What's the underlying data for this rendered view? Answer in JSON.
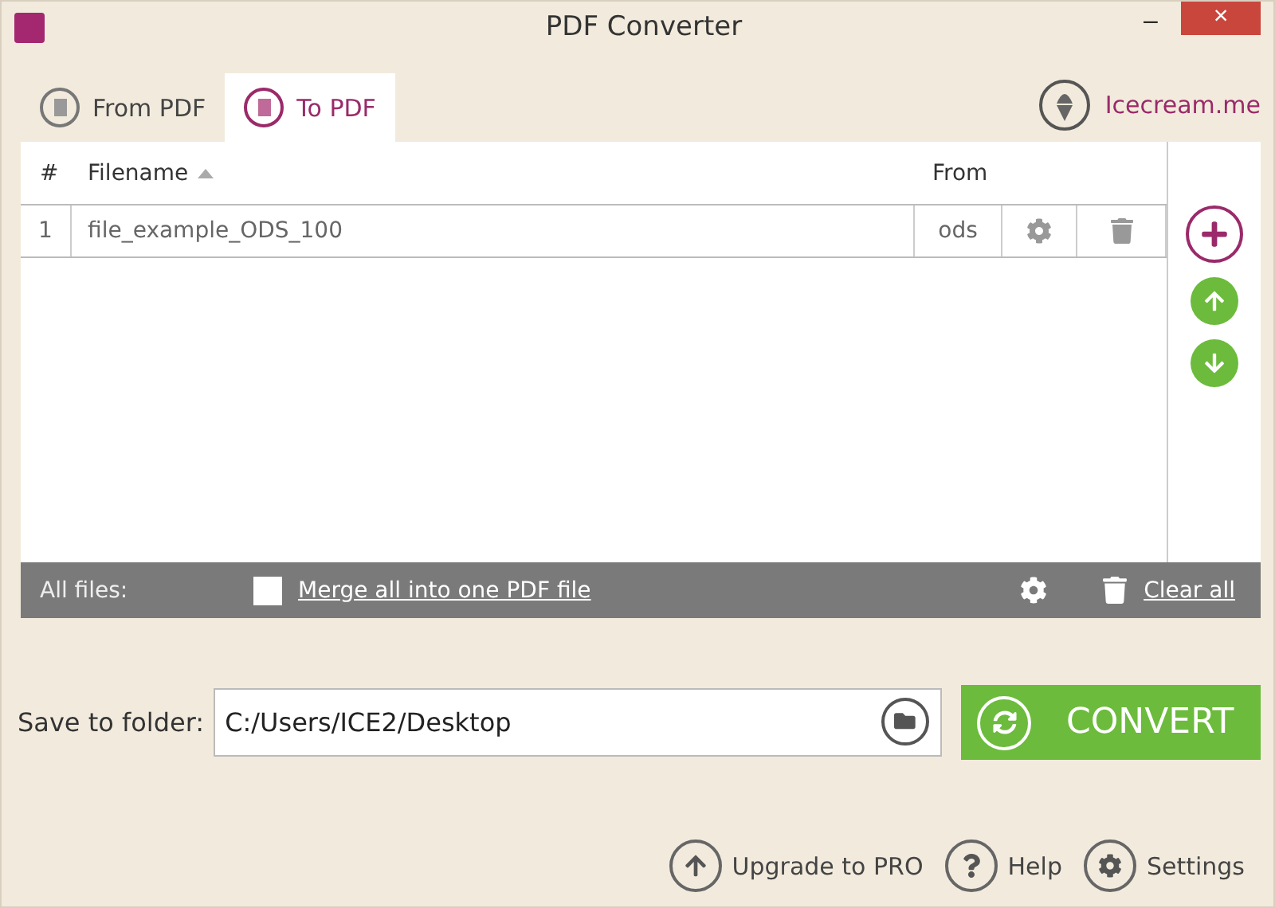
{
  "window": {
    "title": "PDF Converter",
    "close": "×",
    "minimize": "–"
  },
  "tabs": [
    {
      "label": "From PDF",
      "selected": false
    },
    {
      "label": "To PDF",
      "selected": true
    }
  ],
  "brand_link": "Icecream.me",
  "table": {
    "columns": [
      {
        "label": "#",
        "sorted": false
      },
      {
        "label": "Filename",
        "sorted": true
      },
      {
        "label": "From",
        "sorted": false
      }
    ],
    "rows": [
      {
        "index": "1",
        "filename": "file_example_ODS_100",
        "from": "ods"
      }
    ]
  },
  "footer": {
    "label": "All files:",
    "merge": {
      "label": "Merge all into one PDF file",
      "checked": false
    },
    "clear": "Clear all"
  },
  "save": {
    "label": "Save to folder:",
    "value": "C:/Users/ICE2/Desktop"
  },
  "convert": "CONVERT",
  "bottom_links": [
    {
      "kind": "upgrade",
      "label": "Upgrade to PRO"
    },
    {
      "kind": "help",
      "label": "Help"
    },
    {
      "kind": "settings",
      "label": "Settings"
    }
  ]
}
